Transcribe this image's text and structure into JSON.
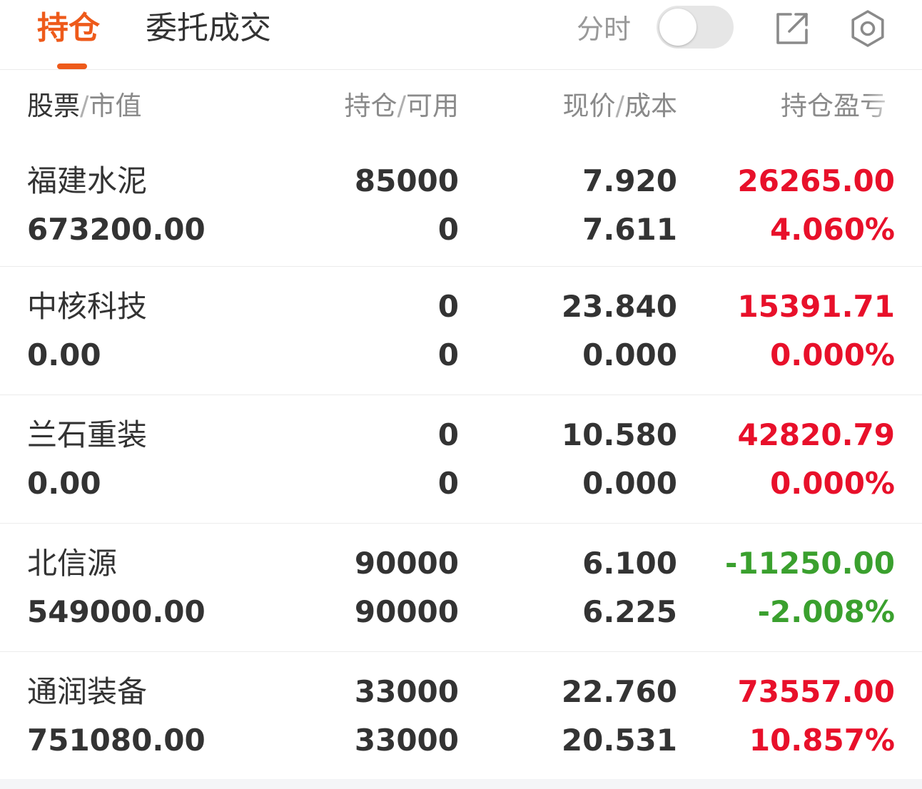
{
  "tabs": {
    "holdings": "持仓",
    "orders": "委托成交"
  },
  "toolbar": {
    "timeshare_label": "分时",
    "timeshare_on": false
  },
  "colors": {
    "accent": "#ee5a1a",
    "profit": "#e8102a",
    "loss": "#3aa02e"
  },
  "header": {
    "col1_main": "股票",
    "col1_sub": "市值",
    "col2_main": "持仓",
    "col2_sub": "可用",
    "col3_main": "现价",
    "col3_sub": "成本",
    "col4": "持仓盈亏",
    "separator": "/"
  },
  "positions": [
    {
      "name": "福建水泥",
      "market_value": "673200.00",
      "holding": "85000",
      "available": "0",
      "price": "7.920",
      "cost": "7.611",
      "pnl": "26265.00",
      "pnl_pct": "4.060%",
      "trend": "up"
    },
    {
      "name": "中核科技",
      "market_value": "0.00",
      "holding": "0",
      "available": "0",
      "price": "23.840",
      "cost": "0.000",
      "pnl": "15391.71",
      "pnl_pct": "0.000%",
      "trend": "up"
    },
    {
      "name": "兰石重装",
      "market_value": "0.00",
      "holding": "0",
      "available": "0",
      "price": "10.580",
      "cost": "0.000",
      "pnl": "42820.79",
      "pnl_pct": "0.000%",
      "trend": "up"
    },
    {
      "name": "北信源",
      "market_value": "549000.00",
      "holding": "90000",
      "available": "90000",
      "price": "6.100",
      "cost": "6.225",
      "pnl": "-11250.00",
      "pnl_pct": "-2.008%",
      "trend": "down"
    },
    {
      "name": "通润装备",
      "market_value": "751080.00",
      "holding": "33000",
      "available": "33000",
      "price": "22.760",
      "cost": "20.531",
      "pnl": "73557.00",
      "pnl_pct": "10.857%",
      "trend": "up"
    }
  ]
}
